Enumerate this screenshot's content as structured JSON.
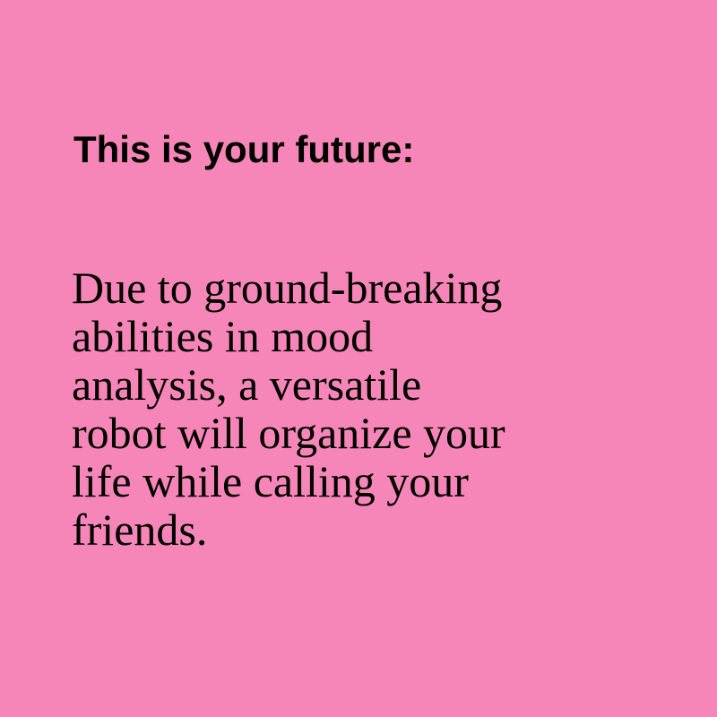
{
  "heading": "This is your future:",
  "body_lines": [
    "Due to ground-breaking",
    "abilities in mood",
    "analysis, a versatile",
    "robot will organize your",
    "life while calling your",
    "friends."
  ],
  "colors": {
    "background": "#f786b8",
    "text": "#000000"
  }
}
